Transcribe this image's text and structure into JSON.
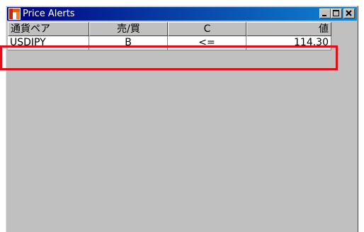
{
  "window": {
    "title": "Price Alerts"
  },
  "columns": [
    "通貨ペア",
    "売/買",
    "C",
    "値"
  ],
  "rows": [
    {
      "pair": "USDJPY",
      "side": "B",
      "condition": "<=",
      "price": "114.30"
    }
  ],
  "colors": {
    "titlebar_start": "#000080",
    "titlebar_end": "#1084d0",
    "window_bg": "#c0c0c0",
    "highlight": "#e0101b"
  },
  "icons": {
    "app": "app-icon",
    "minimize": "minimize-icon",
    "maximize": "maximize-icon",
    "close": "close-icon"
  }
}
